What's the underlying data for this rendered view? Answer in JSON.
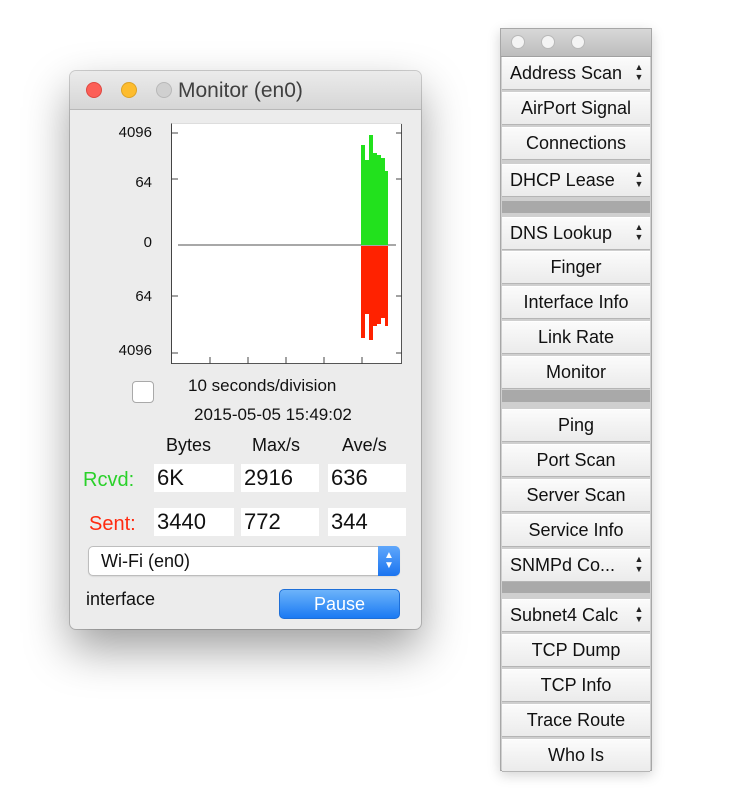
{
  "monitor": {
    "title": "Monitor (en0)",
    "y_labels": [
      "4096",
      "64",
      "0",
      "64",
      "4096"
    ],
    "scale_text": "10 seconds/division",
    "datetime": "2015-05-05 15:49:02",
    "columns": [
      "Bytes",
      "Max/s",
      "Ave/s"
    ],
    "rows": [
      {
        "label": "Rcvd:",
        "bytes": "6K",
        "max": "2916",
        "ave": "636",
        "color": "#2ad12a"
      },
      {
        "label": "Sent:",
        "bytes": "3440",
        "max": "772",
        "ave": "344",
        "color": "#ff2a10"
      }
    ],
    "interface_select": "Wi-Fi (en0)",
    "interface_label": "interface",
    "pause_label": "Pause",
    "graph": {
      "recv_color": "#22e11d",
      "sent_color": "#ff2200"
    }
  },
  "palette": {
    "tools": [
      {
        "label": "Address Scan",
        "menu": true
      },
      {
        "label": "AirPort Signal",
        "menu": false
      },
      {
        "label": "Connections",
        "menu": false
      },
      {
        "label": "DHCP Lease",
        "menu": true
      },
      {
        "label": "DNS Lookup",
        "menu": true
      },
      {
        "label": "Finger",
        "menu": false
      },
      {
        "label": "Interface Info",
        "menu": false
      },
      {
        "label": "Link Rate",
        "menu": false
      },
      {
        "label": "Monitor",
        "menu": false
      },
      {
        "label": "Ping",
        "menu": false
      },
      {
        "label": "Port Scan",
        "menu": false
      },
      {
        "label": "Server Scan",
        "menu": false
      },
      {
        "label": "Service Info",
        "menu": false
      },
      {
        "label": "SNMPd Co...",
        "menu": true
      },
      {
        "label": "Subnet4 Calc",
        "menu": true
      },
      {
        "label": "TCP Dump",
        "menu": false
      },
      {
        "label": "TCP Info",
        "menu": false
      },
      {
        "label": "Trace Route",
        "menu": false
      },
      {
        "label": "Who Is",
        "menu": false
      }
    ]
  }
}
